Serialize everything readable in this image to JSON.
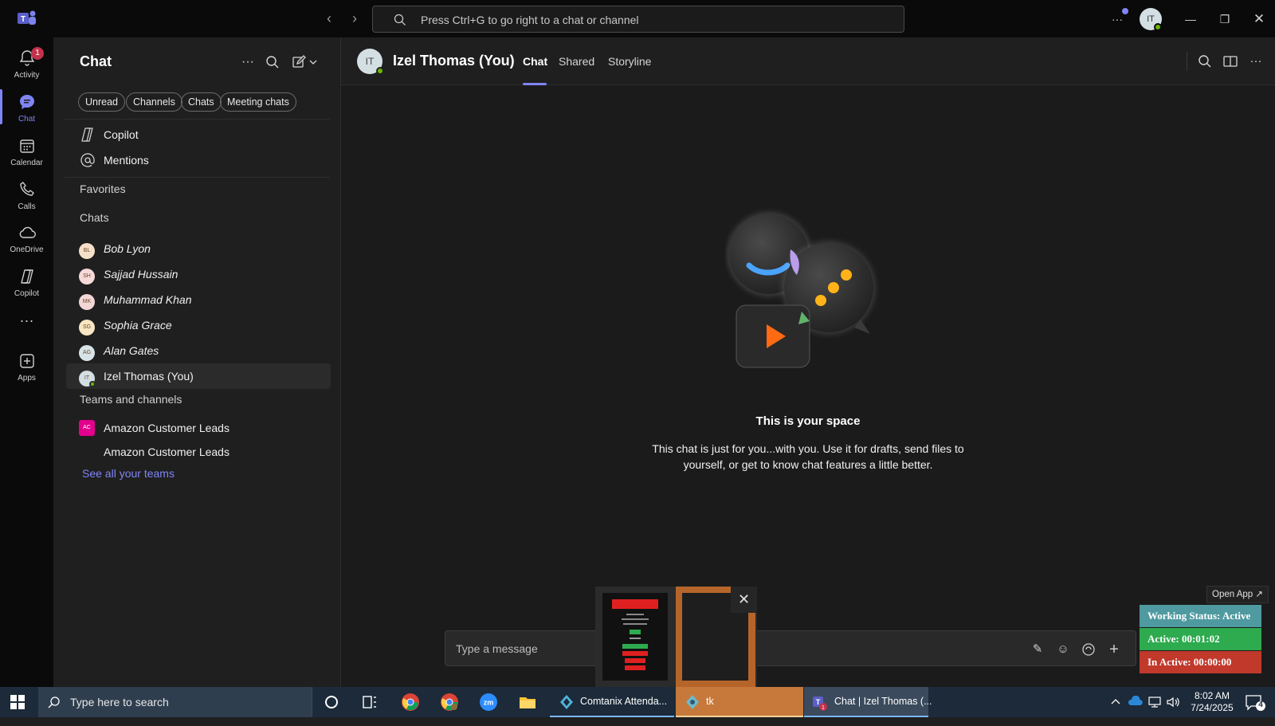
{
  "titlebar": {
    "search_placeholder": "Press Ctrl+G to go right to a chat or channel",
    "user_initials": "IT"
  },
  "rail": {
    "items": [
      {
        "label": "Activity",
        "icon": "bell-icon",
        "badge": "1"
      },
      {
        "label": "Chat",
        "icon": "chat-icon"
      },
      {
        "label": "Calendar",
        "icon": "calendar-icon"
      },
      {
        "label": "Calls",
        "icon": "phone-icon"
      },
      {
        "label": "OneDrive",
        "icon": "cloud-icon"
      },
      {
        "label": "Copilot",
        "icon": "copilot-icon"
      },
      {
        "label": "Apps",
        "icon": "add-apps-icon"
      }
    ]
  },
  "chatlist": {
    "title": "Chat",
    "filters": [
      "Unread",
      "Channels",
      "Chats",
      "Meeting chats"
    ],
    "pinned": [
      {
        "label": "Copilot",
        "icon": "copilot-icon"
      },
      {
        "label": "Mentions",
        "icon": "at-icon"
      }
    ],
    "favorites_heading": "Favorites",
    "chats_heading": "Chats",
    "chats": [
      {
        "name": "Bob Lyon",
        "initials": "BL",
        "color": "#f6e0c9"
      },
      {
        "name": "Sajjad Hussain",
        "initials": "SH",
        "color": "#f7d9d9"
      },
      {
        "name": "Muhammad Khan",
        "initials": "MK",
        "color": "#f3d6d6"
      },
      {
        "name": "Sophia Grace",
        "initials": "SG",
        "color": "#f9e6c3"
      },
      {
        "name": "Alan Gates",
        "initials": "AG",
        "color": "#d7e3e6"
      },
      {
        "name": "Izel Thomas (You)",
        "initials": "IT",
        "color": "#d4dfe4"
      }
    ],
    "teams_heading": "Teams and channels",
    "team": {
      "name": "Amazon Customer Leads",
      "initials": "AC",
      "channel": "Amazon Customer Leads"
    },
    "see_all": "See all your teams"
  },
  "main": {
    "initials": "IT",
    "name": "Izel Thomas (You)",
    "tabs": [
      "Chat",
      "Shared",
      "Storyline"
    ],
    "empty_title": "This is your space",
    "empty_text": "This chat is just for you...with you. Use it for drafts, send files to yourself, or get to know chat features a little better.",
    "composer_placeholder": "Type a message"
  },
  "widget": {
    "open_app": "Open App ↗",
    "status": "Working Status: Active",
    "active": "Active: 00:01:02",
    "inactive": "In Active: 00:00:00",
    "status_color": "#4f9aa0",
    "active_color": "#2eaa4f",
    "inactive_color": "#c0392b"
  },
  "taskbar": {
    "search_placeholder": "Type here to search",
    "apps": [
      {
        "label": "Comtanix Attenda..."
      },
      {
        "label": "tk"
      },
      {
        "label": "Chat | Izel Thomas (..."
      }
    ],
    "time": "8:02 AM",
    "date": "7/24/2025",
    "notification_count": "4"
  },
  "colors": {
    "accent": "#7f85f5"
  }
}
